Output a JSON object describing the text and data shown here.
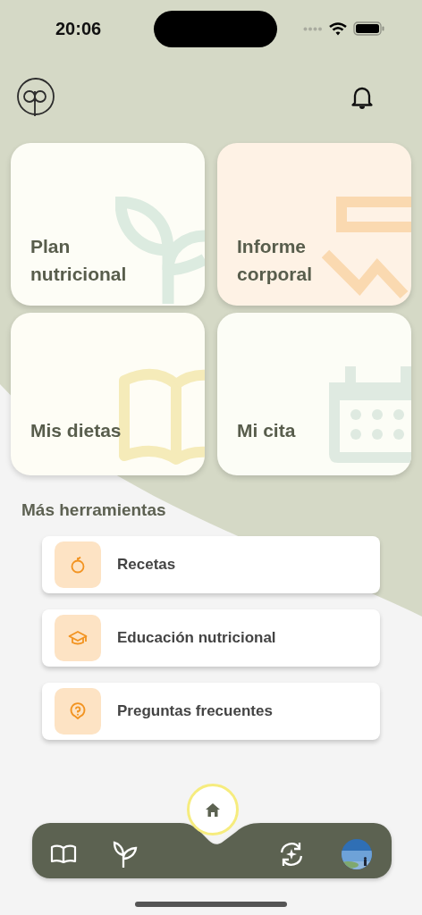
{
  "status_bar": {
    "time": "20:06"
  },
  "tiles": [
    {
      "label": "Plan nutricional",
      "kind": "plant",
      "color": "#fdfdf6"
    },
    {
      "label": "Informe corporal",
      "kind": "chart",
      "color": "#fef2e5"
    },
    {
      "label": "Mis dietas",
      "kind": "book",
      "color": "#fefdf5"
    },
    {
      "label": "Mi cita",
      "kind": "calendar",
      "color": "#fcfdf6"
    }
  ],
  "section_title": "Más herramientas",
  "tools": [
    {
      "label": "Recetas",
      "kind": "fruit"
    },
    {
      "label": "Educación nutricional",
      "kind": "education"
    },
    {
      "label": "Preguntas frecuentes",
      "kind": "question"
    }
  ],
  "nav": {
    "items": [
      {
        "kind": "book",
        "selected": false
      },
      {
        "kind": "plant",
        "selected": false
      },
      {
        "kind": "home",
        "selected": true
      },
      {
        "kind": "sync",
        "selected": false
      },
      {
        "kind": "avatar",
        "selected": false
      }
    ]
  }
}
